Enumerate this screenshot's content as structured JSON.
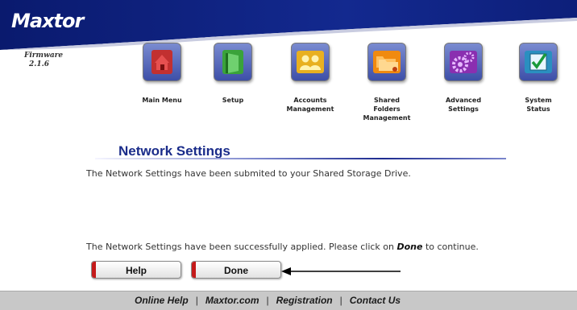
{
  "brand": {
    "logo": "Maxtor"
  },
  "firmware": {
    "label": "Firmware",
    "version": "2.1.6"
  },
  "nav": {
    "items": [
      {
        "label_lines": [
          "Main Menu"
        ],
        "icon": "house-icon",
        "color": "#c03030"
      },
      {
        "label_lines": [
          "Setup"
        ],
        "icon": "door-icon",
        "color": "#3aa33a"
      },
      {
        "label_lines": [
          "Accounts",
          "Management"
        ],
        "icon": "users-icon",
        "color": "#e8b020"
      },
      {
        "label_lines": [
          "Shared",
          "Folders",
          "Management"
        ],
        "icon": "folders-icon",
        "color": "#f08a10"
      },
      {
        "label_lines": [
          "Advanced",
          "Settings"
        ],
        "icon": "gears-icon",
        "color": "#8a2fb0"
      },
      {
        "label_lines": [
          "System",
          "Status"
        ],
        "icon": "checkbox-icon",
        "color": "#2a8fc0"
      }
    ]
  },
  "main": {
    "title": "Network Settings",
    "message1": "The Network Settings have been submited to your Shared Storage Drive.",
    "message2_before": "The Network Settings have been successfully applied. Please click on ",
    "message2_bold": "Done",
    "message2_after": " to continue."
  },
  "buttons": {
    "help": "Help",
    "done": "Done"
  },
  "footer": {
    "links": [
      "Online Help",
      "Maxtor.com",
      "Registration",
      "Contact Us"
    ],
    "separator": "|"
  },
  "colors": {
    "header_blue": "#0d1f7a",
    "title_blue": "#1a2c8a",
    "button_accent": "#c41a1a",
    "footer_gray": "#c8c8c8"
  }
}
